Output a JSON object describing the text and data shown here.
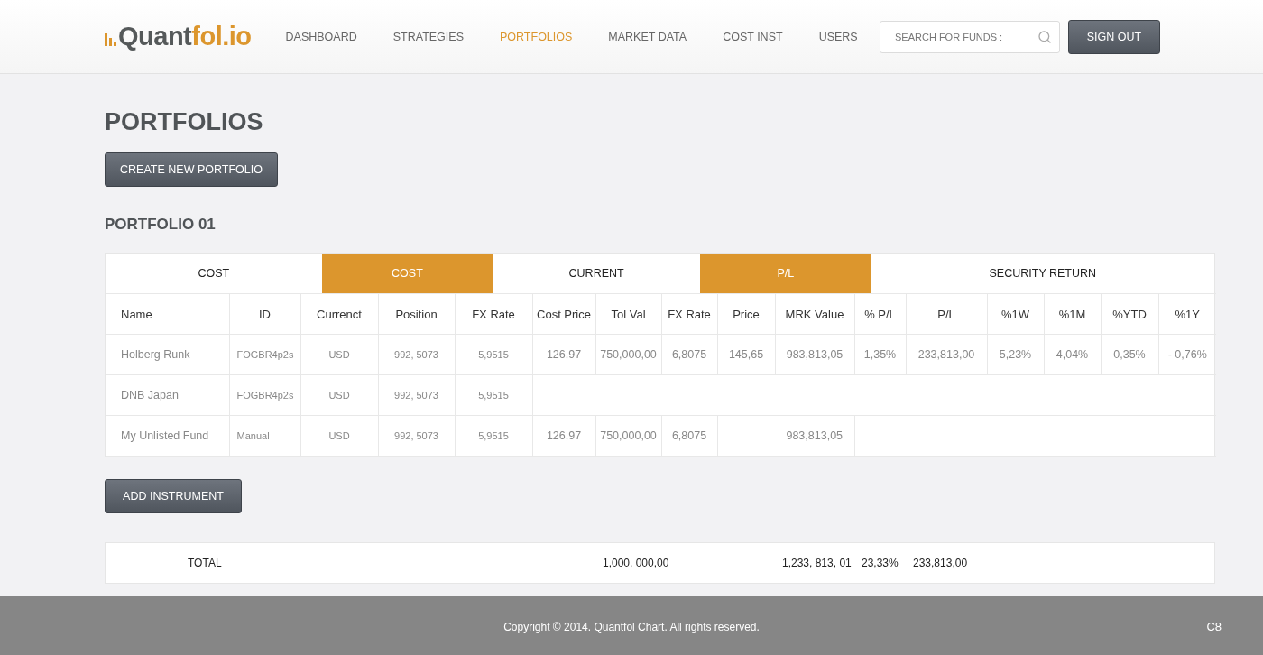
{
  "logo": {
    "dark": "Quant",
    "accent": "fol.io"
  },
  "nav": [
    {
      "label": "DASHBOARD",
      "selected": false
    },
    {
      "label": "STRATEGIES",
      "selected": false
    },
    {
      "label": "PORTFOLIOS",
      "selected": true
    },
    {
      "label": "MARKET DATA",
      "selected": false
    },
    {
      "label": "COST INST",
      "selected": false
    },
    {
      "label": "USERS",
      "selected": false
    }
  ],
  "search": {
    "placeholder": "SEARCH FOR FUNDS :"
  },
  "sign_out": "SIGN OUT",
  "page_title": "PORTFOLIOS",
  "create_button": "CREATE NEW PORTFOLIO",
  "portfolio": {
    "title": "PORTFOLIO 01",
    "groups": [
      {
        "label": "COST",
        "highlighted": false
      },
      {
        "label": "COST",
        "highlighted": true
      },
      {
        "label": "CURRENT",
        "highlighted": false
      },
      {
        "label": "P/L",
        "highlighted": true
      },
      {
        "label": "SECURITY RETURN",
        "highlighted": false
      }
    ],
    "columns": [
      "Name",
      "ID",
      "Currenct",
      "Position",
      "FX Rate",
      "Cost Price",
      "Tol Val",
      "FX Rate",
      "Price",
      "MRK Value",
      "% P/L",
      "P/L",
      "%1W",
      "%1M",
      "%YTD",
      "%1Y"
    ],
    "rows": [
      [
        "Holberg Runk",
        "FOGBR4p2s",
        "USD",
        "992, 5073",
        "5,9515",
        "126,97",
        "750,000,00",
        "6,8075",
        "145,65",
        "983,813,05",
        "1,35%",
        "233,813,00",
        "5,23%",
        "4,04%",
        "0,35%",
        "- 0,76%"
      ],
      [
        "DNB Japan",
        "FOGBR4p2s",
        "USD",
        "992, 5073",
        "5,9515"
      ],
      [
        "My Unlisted Fund",
        "Manual",
        "USD",
        "992, 5073",
        "5,9515",
        "126,97",
        "750,000,00",
        "6,8075",
        null,
        "983,813,05"
      ]
    ],
    "add_button": "ADD INSTRUMENT",
    "total": {
      "label": "TOTAL",
      "tol_val": "1,000, 000,00",
      "mrk_value": "1,233, 813, 01",
      "pct_pl": "23,33%",
      "pl": "233,813,00"
    }
  },
  "footer": {
    "copyright": "Copyright © 2014. Quantfol Chart. All rights reserved.",
    "code": "C8"
  }
}
